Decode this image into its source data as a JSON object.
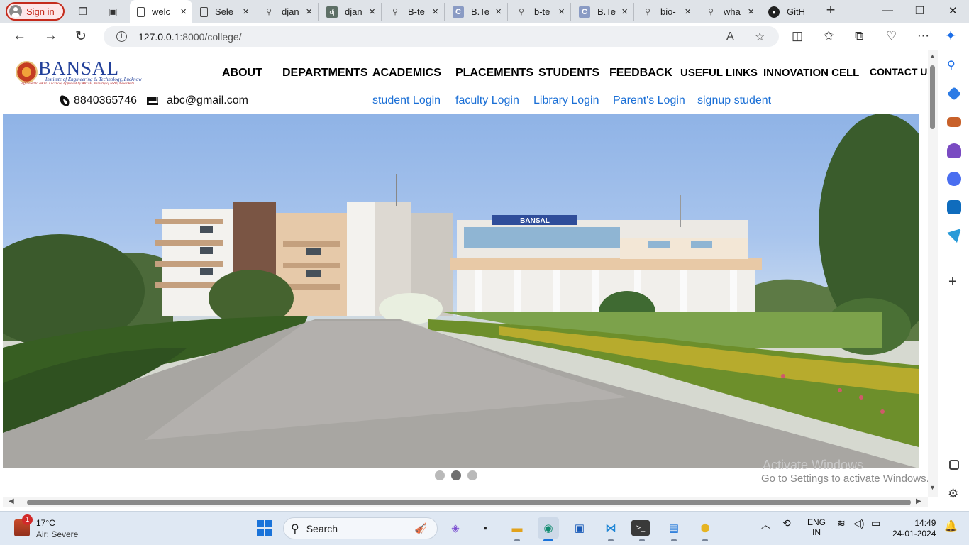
{
  "browser": {
    "signin_label": "Sign in",
    "tabs": [
      {
        "title": "welc",
        "icon": "document-icon",
        "active": true
      },
      {
        "title": "Sele",
        "icon": "document-icon"
      },
      {
        "title": "djan",
        "icon": "search-icon"
      },
      {
        "title": "djan",
        "icon": "dj-favicon-icon"
      },
      {
        "title": "B-te",
        "icon": "search-icon"
      },
      {
        "title": "B.Te",
        "icon": "c-favicon-icon"
      },
      {
        "title": "b-te",
        "icon": "search-icon"
      },
      {
        "title": "B.Te",
        "icon": "c-favicon-icon"
      },
      {
        "title": "bio-",
        "icon": "search-icon"
      },
      {
        "title": "wha",
        "icon": "search-icon"
      },
      {
        "title": "GitH",
        "icon": "github-icon"
      }
    ],
    "url_host": "127.0.0.1",
    "url_path": ":8000/college/"
  },
  "site": {
    "logo_name": "BANSAL",
    "logo_tagline": "Institute of Engineering & Technology, Lucknow",
    "logo_affiliation": "Affiliated to AKTU Lucknow, Approved by AICTE, Ministry of HRD, New Delhi",
    "nav": [
      "ABOUT",
      "DEPARTMENTS",
      "ACADEMICS",
      "PLACEMENTS",
      "STUDENTS",
      "FEEDBACK",
      "USEFUL LINKS",
      "INNOVATION CELL",
      "CONTACT US"
    ],
    "phone": "8840365746",
    "email": "abc@gmail.com",
    "logins": [
      "student Login",
      "faculty Login",
      "Library Login",
      "Parent's Login",
      "signup student"
    ],
    "hero_sign": "BANSAL",
    "carousel_active_index": 1,
    "carousel_count": 3
  },
  "watermark": {
    "line1": "Activate Windows",
    "line2": "Go to Settings to activate Windows."
  },
  "taskbar": {
    "weather_temp": "17°C",
    "weather_desc": "Air: Severe",
    "weather_badge": "1",
    "search_placeholder": "Search",
    "lang1": "ENG",
    "lang2": "IN",
    "time": "14:49",
    "date": "24-01-2024"
  }
}
